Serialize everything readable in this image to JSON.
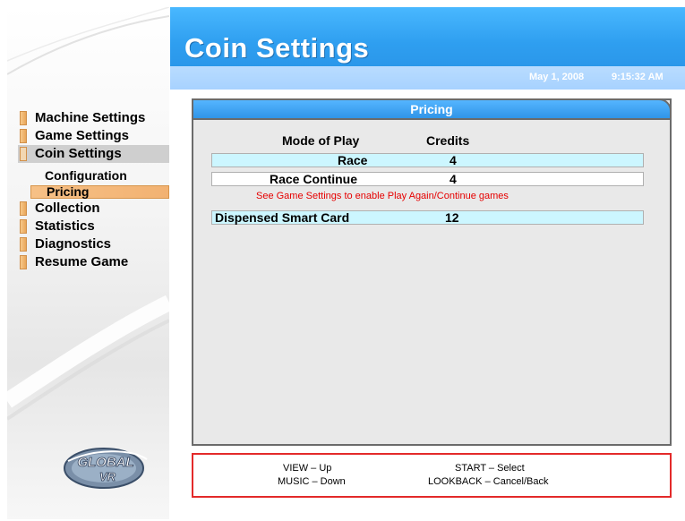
{
  "header": {
    "title": "Coin Settings",
    "date": "May 1, 2008",
    "time": "9:15:32 AM"
  },
  "sidebar": {
    "items": [
      {
        "label": "Machine Settings",
        "selected": false
      },
      {
        "label": "Game Settings",
        "selected": false
      },
      {
        "label": "Coin Settings",
        "selected": true
      },
      {
        "label": "Configuration",
        "sub": true,
        "selected": false
      },
      {
        "label": "Pricing",
        "sub": true,
        "selected": true
      },
      {
        "label": "Collection",
        "selected": false
      },
      {
        "label": "Statistics",
        "selected": false
      },
      {
        "label": "Diagnostics",
        "selected": false
      },
      {
        "label": "Resume Game",
        "selected": false
      }
    ],
    "logo_text": [
      "GLOBAL",
      "VR"
    ]
  },
  "panel": {
    "title": "Pricing",
    "columns": [
      "Mode of Play",
      "Credits"
    ],
    "rows": [
      {
        "label": "Race",
        "value": "4"
      },
      {
        "label": "Race Continue",
        "value": "4"
      }
    ],
    "note": "See Game Settings to enable Play Again/Continue games",
    "dispensed": {
      "label": "Dispensed Smart Card",
      "value": "12"
    }
  },
  "legend": {
    "view_up": "VIEW – Up",
    "music_down": "MUSIC – Down",
    "start_select": "START – Select",
    "lookback_cancel": "LOOKBACK – Cancel/Back"
  },
  "colors": {
    "header_blue": "#2f9ff0",
    "menu_tab": "#e9a65a",
    "row_cyan": "#ccf6ff",
    "note_red": "#e60000",
    "legend_border": "#e32a2a"
  }
}
